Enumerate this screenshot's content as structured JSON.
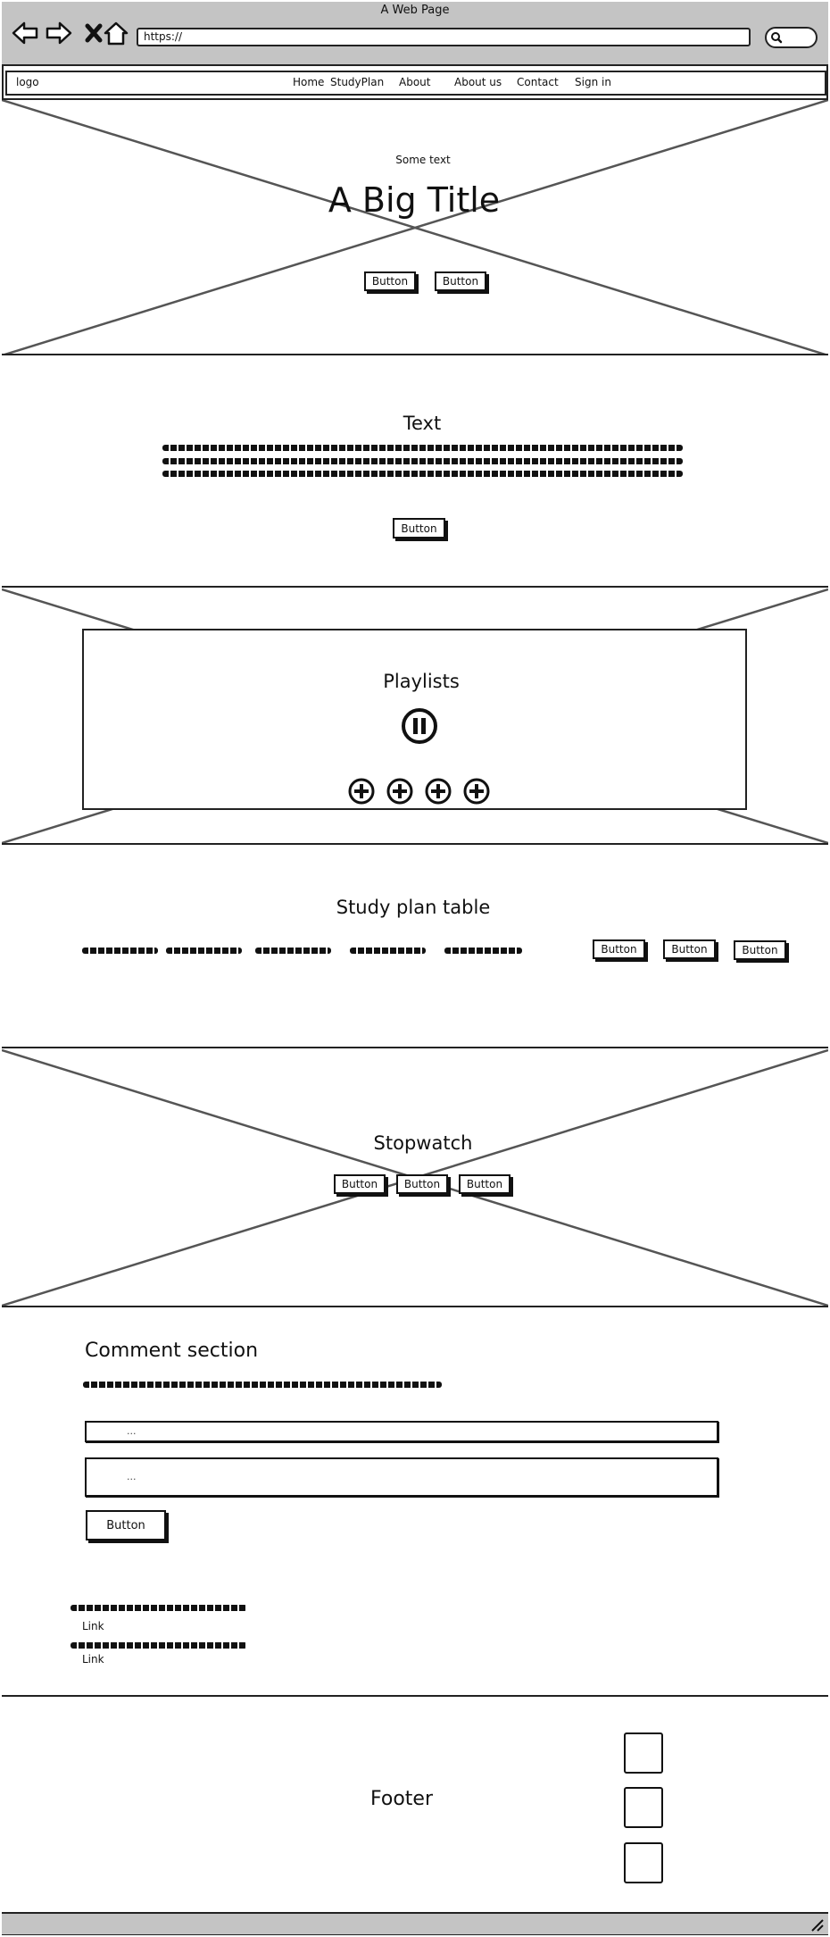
{
  "window": {
    "title": "A Web Page",
    "url": "https://"
  },
  "navbar": {
    "logo": "logo",
    "links": [
      "Home",
      "StudyPlan",
      "About",
      "About us",
      "Contact",
      "Sign in"
    ]
  },
  "hero": {
    "kicker": "Some text",
    "title": "A Big Title",
    "buttons": [
      "Button",
      "Button"
    ]
  },
  "text_section": {
    "heading": "Text",
    "button": "Button"
  },
  "playlists": {
    "heading": "Playlists"
  },
  "study_plan": {
    "heading": "Study plan table",
    "buttons": [
      "Button",
      "Button",
      "Button"
    ]
  },
  "stopwatch": {
    "heading": "Stopwatch",
    "buttons": [
      "Button",
      "Button",
      "Button"
    ]
  },
  "comments": {
    "heading": "Comment section",
    "input_placeholder": "...",
    "textarea_placeholder": "...",
    "button": "Button",
    "links": [
      "Link",
      "Link"
    ]
  },
  "footer": {
    "label": "Footer"
  }
}
